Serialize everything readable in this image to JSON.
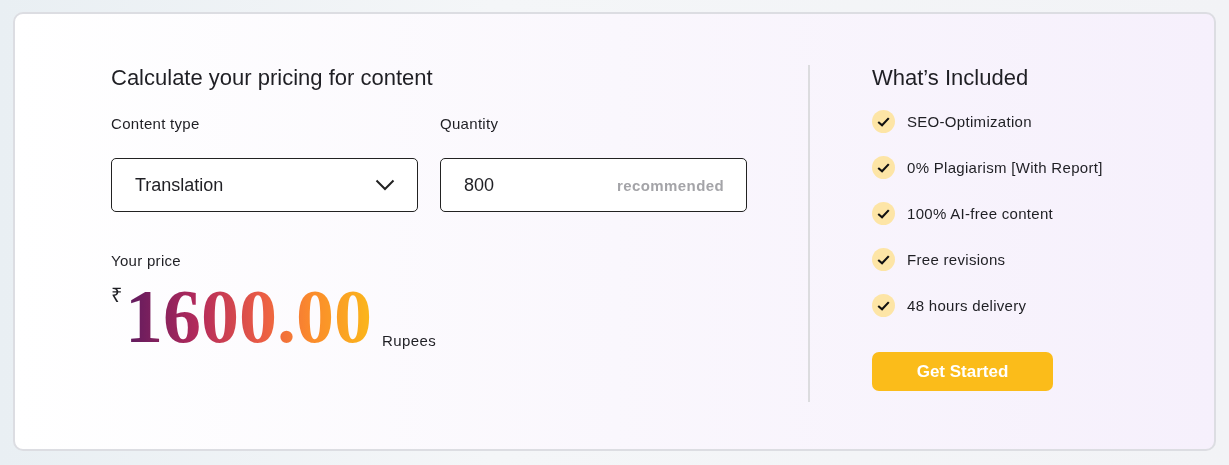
{
  "calculator": {
    "title": "Calculate your pricing for content",
    "content_type": {
      "label": "Content type",
      "value": "Translation"
    },
    "quantity": {
      "label": "Quantity",
      "value": "800",
      "hint": "recommended"
    },
    "price": {
      "label": "Your price",
      "currency_symbol": "₹",
      "amount": "1600.00",
      "unit": "Rupees"
    }
  },
  "included": {
    "title": "What’s Included",
    "items": [
      {
        "label": "SEO-Optimization",
        "checked": true
      },
      {
        "label": "0% Plagiarism [With Report]",
        "checked": true
      },
      {
        "label": "100% AI-free content",
        "checked": true
      },
      {
        "label": "Free revisions",
        "checked": true
      },
      {
        "label": "48 hours delivery",
        "checked": true
      }
    ],
    "button": "Get Started"
  }
}
